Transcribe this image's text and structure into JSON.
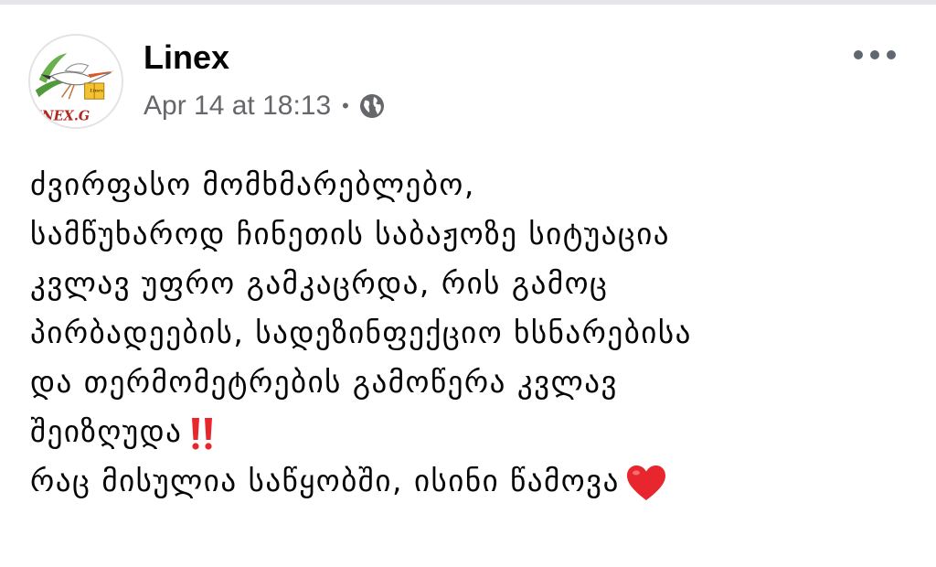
{
  "post": {
    "author": "Linex",
    "timestamp": "Apr 14 at 18:13",
    "separator": "•",
    "privacy_icon": "globe-icon",
    "more_icon": "more-options-icon",
    "avatar": {
      "logo_text": "INEX.G",
      "box_text": "Linex"
    },
    "lines": [
      "ძვირფასო მომხმარებლებო,",
      "სამწუხაროდ ჩინეთის საბაჟოზე სიტუაცია",
      "კვლავ უფრო გამკაცრდა, რის გამოც",
      "პირბადეების, სადეზინფექციო ხსნარებისა",
      "და თერმომეტრების გამოწერა კვლავ",
      "შეიზღუდა",
      "რაც მისულია საწყობში, ისინი წამოვა"
    ],
    "emoji": {
      "exclamation": "double-exclamation-icon",
      "heart": "red-heart-icon"
    }
  },
  "colors": {
    "text": "#050505",
    "meta": "#65676b",
    "emoji_red": "#e8262d"
  }
}
